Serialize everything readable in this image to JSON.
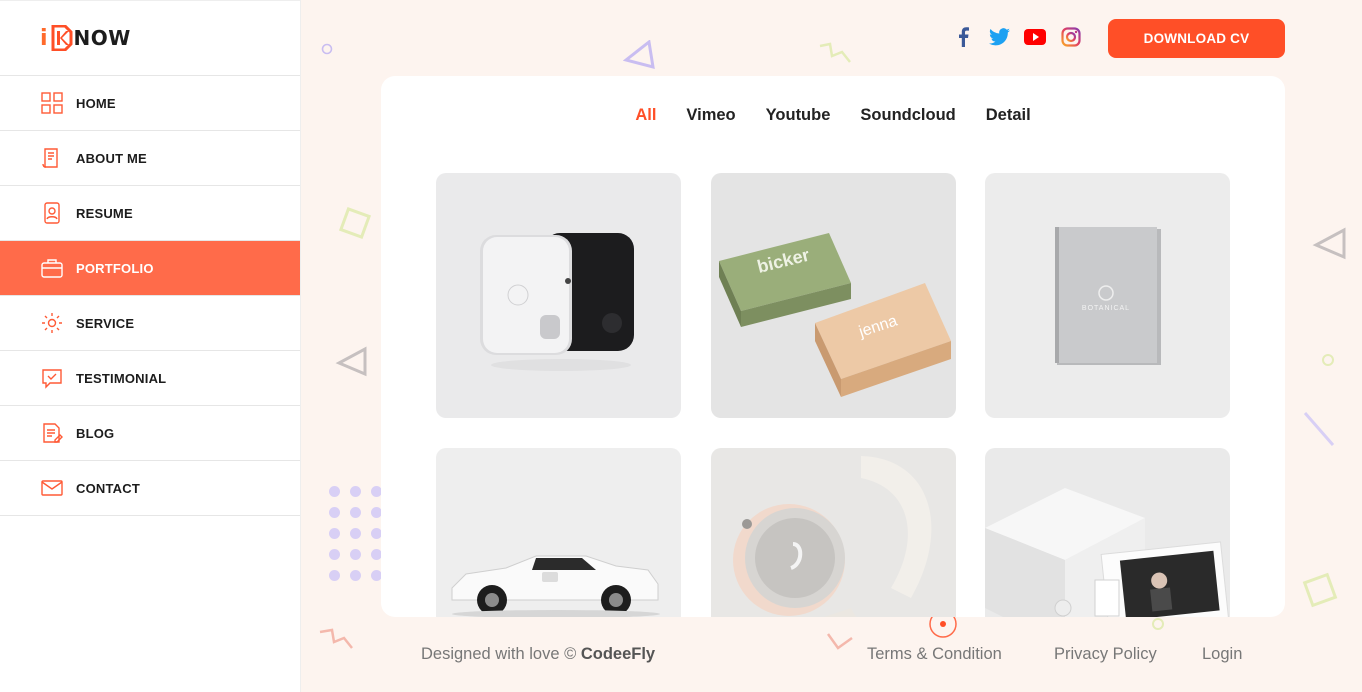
{
  "brand": {
    "prefix": "i",
    "word": "NOW"
  },
  "nav": [
    {
      "label": "HOME",
      "icon": "grid-icon",
      "active": false
    },
    {
      "label": "ABOUT ME",
      "icon": "resume-doc-icon",
      "active": false
    },
    {
      "label": "RESUME",
      "icon": "contact-card-icon",
      "active": false
    },
    {
      "label": "PORTFOLIO",
      "icon": "briefcase-icon",
      "active": true
    },
    {
      "label": "SERVICE",
      "icon": "gear-icon",
      "active": false
    },
    {
      "label": "TESTIMONIAL",
      "icon": "chat-check-icon",
      "active": false
    },
    {
      "label": "BLOG",
      "icon": "edit-doc-icon",
      "active": false
    },
    {
      "label": "CONTACT",
      "icon": "mail-icon",
      "active": false
    }
  ],
  "social": [
    "facebook-icon",
    "twitter-icon",
    "youtube-icon",
    "instagram-icon"
  ],
  "download_label": "DOWNLOAD CV",
  "filters": [
    {
      "label": "All",
      "active": true
    },
    {
      "label": "Vimeo",
      "active": false
    },
    {
      "label": "Youtube",
      "active": false
    },
    {
      "label": "Soundcloud",
      "active": false
    },
    {
      "label": "Detail",
      "active": false
    }
  ],
  "portfolio": [
    {
      "name": "speaker-device-image"
    },
    {
      "name": "business-cards-image",
      "text1": "bicker",
      "text2": "jenna"
    },
    {
      "name": "book-image",
      "text1": "BOTANICAL"
    },
    {
      "name": "sports-car-image"
    },
    {
      "name": "smartwatch-image"
    },
    {
      "name": "packaging-box-image"
    }
  ],
  "footer": {
    "designed": "Designed with love ©",
    "author": "CodeeFly",
    "terms": "Terms & Condition",
    "privacy": "Privacy Policy",
    "login": "Login"
  },
  "colors": {
    "accent": "#ff4f27",
    "active_nav": "#ff6b4a",
    "background": "#fdf4ef"
  }
}
